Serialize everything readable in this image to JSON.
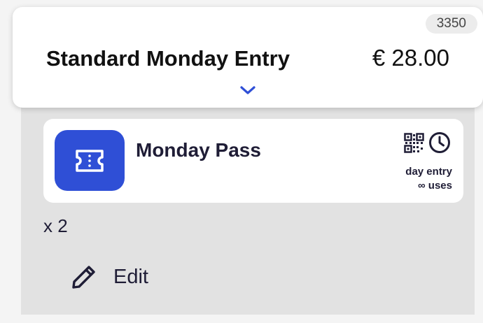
{
  "product": {
    "id_badge": "3350",
    "title": "Standard Monday Entry",
    "price": "€ 28.00",
    "expand_icon": "chevron-down-icon"
  },
  "pass": {
    "name": "Monday Pass",
    "icon": "ticket-icon",
    "icon_color": "#2f4fd6",
    "meta_icons": [
      "qr-code-icon",
      "clock-icon"
    ],
    "validity": "day entry",
    "uses": "∞ uses"
  },
  "quantity": "x 2",
  "edit": {
    "label": "Edit",
    "icon": "pencil-icon"
  },
  "colors": {
    "accent": "#2f4fd6",
    "text": "#1f1d36",
    "panel": "#e2e2e2"
  }
}
